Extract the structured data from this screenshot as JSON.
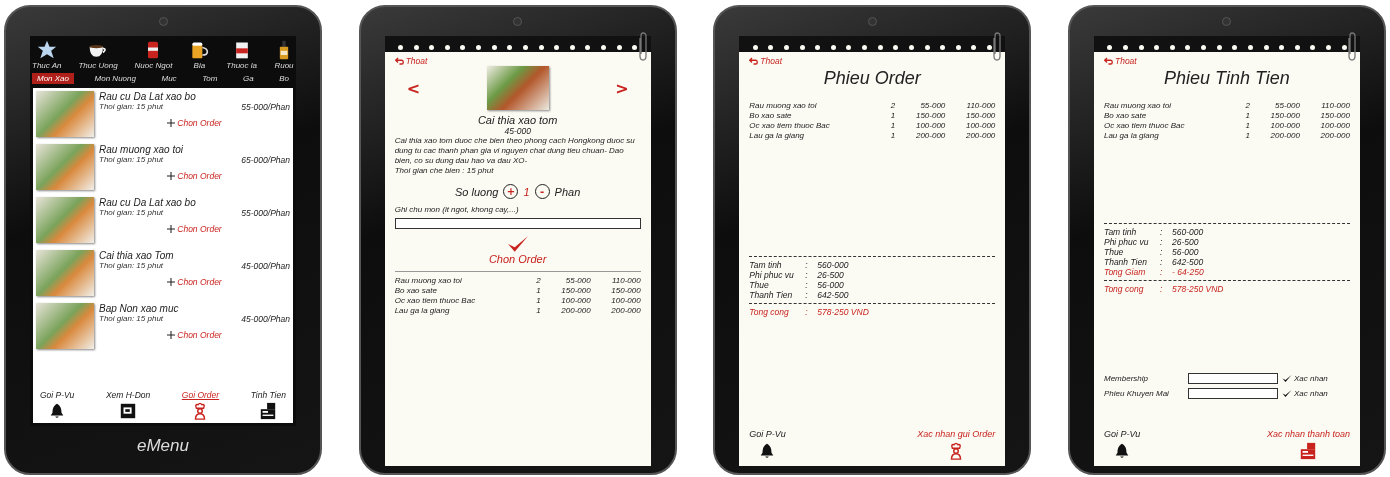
{
  "screens": [
    {
      "kind": "menu",
      "categories": [
        {
          "label": "Thuc An",
          "kind": "food"
        },
        {
          "label": "Thuc Uong",
          "kind": "coffee"
        },
        {
          "label": "Nuoc Ngot",
          "kind": "soda"
        },
        {
          "label": "Bia",
          "kind": "beer"
        },
        {
          "label": "Thuoc la",
          "kind": "tobacco"
        },
        {
          "label": "Ruou",
          "kind": "liquor"
        }
      ],
      "subcategories": [
        {
          "label": "Mon Xao",
          "selected": true
        },
        {
          "label": "Mon Nuong",
          "selected": false
        },
        {
          "label": "Muc",
          "selected": false
        },
        {
          "label": "Tom",
          "selected": false
        },
        {
          "label": "Ga",
          "selected": false
        },
        {
          "label": "Bo",
          "selected": false
        }
      ],
      "items": [
        {
          "name": "Rau cu Da Lat xao bo",
          "time": "Thoi gian: 15 phut",
          "price": "55-000/Phan",
          "action": "Chon Order"
        },
        {
          "name": "Rau muong xao toi",
          "time": "Thoi gian: 15 phut",
          "price": "65-000/Phan",
          "action": "Chon Order"
        },
        {
          "name": "Rau cu Da Lat xao bo",
          "time": "Thoi gian: 15 phut",
          "price": "55-000/Phan",
          "action": "Chon Order"
        },
        {
          "name": "Cai thia xao Tom",
          "time": "Thoi gian: 15 phut",
          "price": "45-000/Phan",
          "action": "Chon Order"
        },
        {
          "name": "Bap Non xao muc",
          "time": "Thoi gian: 15 phut",
          "price": "45-000/Phan",
          "action": "Chon Order"
        }
      ],
      "nav": [
        {
          "label": "Goi P-Vu",
          "kind": "service",
          "selected": false
        },
        {
          "label": "Xem H-Don",
          "kind": "invoice",
          "selected": false
        },
        {
          "label": "Goi Order",
          "kind": "order",
          "selected": true
        },
        {
          "label": "Tinh Tien",
          "kind": "payment",
          "selected": false
        }
      ],
      "brand": "eMenu"
    },
    {
      "kind": "detail",
      "exit": "Thoat",
      "prev": "<",
      "next": ">",
      "dish_name": "Cai thia xao tom",
      "price": "45-000",
      "description": "Cai thia xao tom duoc che bien theo phong cach Hongkong duoc su dung tu cac thanh phan gia vi nguyen chat dung tieu chuan- Dao bien, co su dung dau hao va dau XO-",
      "cook_time": "Thoi gian che bien : 15 phut",
      "quantity_label": "So luong",
      "plus": "+",
      "quantity": "1",
      "minus": "-",
      "unit": "Phan",
      "note_label": "Ghi chu mon (it ngot, khong cay,...)",
      "confirm": "Chon Order",
      "order_lines": [
        {
          "name": "Rau muong xao toi",
          "qty": "2",
          "price": "55-000",
          "amount": "110-000"
        },
        {
          "name": "Bo xao sate",
          "qty": "1",
          "price": "150-000",
          "amount": "150-000"
        },
        {
          "name": "Oc xao tiem thuoc Bac",
          "qty": "1",
          "price": "100-000",
          "amount": "100-000"
        },
        {
          "name": "Lau ga la giang",
          "qty": "1",
          "price": "200-000",
          "amount": "200-000"
        }
      ]
    },
    {
      "kind": "receipt",
      "exit": "Thoat",
      "title": "Phieu Order",
      "order_lines": [
        {
          "name": "Rau muong xao toi",
          "qty": "2",
          "price": "55-000",
          "amount": "110-000"
        },
        {
          "name": "Bo xao sate",
          "qty": "1",
          "price": "150-000",
          "amount": "150-000"
        },
        {
          "name": "Oc xao tiem thuoc Bac",
          "qty": "1",
          "price": "100-000",
          "amount": "100-000"
        },
        {
          "name": "Lau ga la giang",
          "qty": "1",
          "price": "200-000",
          "amount": "200-000"
        }
      ],
      "totals": [
        {
          "label": "Tam tinh",
          "sep": ":",
          "value": "560-000",
          "highlight": false
        },
        {
          "label": "Phi phuc vu",
          "sep": ":",
          "value": "26-500",
          "highlight": false
        },
        {
          "label": "Thue",
          "sep": ":",
          "value": "56-000",
          "highlight": false
        },
        {
          "label": "Thanh Tien",
          "sep": ":",
          "value": "642-500",
          "highlight": false
        }
      ],
      "grand_total": {
        "label": "Tong cong",
        "sep": ":",
        "value": "578-250 VND"
      },
      "footer_left": {
        "label": "Goi P-Vu",
        "kind": "service"
      },
      "footer_right": {
        "label": "Xac nhan gui Order",
        "kind": "order"
      }
    },
    {
      "kind": "receipt",
      "exit": "Thoat",
      "title": "Phieu Tinh Tien",
      "order_lines": [
        {
          "name": "Rau muong xao toi",
          "qty": "2",
          "price": "55-000",
          "amount": "110-000"
        },
        {
          "name": "Bo xao sate",
          "qty": "1",
          "price": "150-000",
          "amount": "150-000"
        },
        {
          "name": "Oc xao tiem thuoc Bac",
          "qty": "1",
          "price": "100-000",
          "amount": "100-000"
        },
        {
          "name": "Lau ga la giang",
          "qty": "1",
          "price": "200-000",
          "amount": "200-000"
        }
      ],
      "totals": [
        {
          "label": "Tam tinh",
          "sep": ":",
          "value": "560-000",
          "highlight": false
        },
        {
          "label": "Phi phuc vu",
          "sep": ":",
          "value": "26-500",
          "highlight": false
        },
        {
          "label": "Thue",
          "sep": ":",
          "value": "56-000",
          "highlight": false
        },
        {
          "label": "Thanh Tien",
          "sep": ":",
          "value": "642-500",
          "highlight": false
        },
        {
          "label": "Tong Giam",
          "sep": ":",
          "value": "- 64-250",
          "highlight": true
        }
      ],
      "grand_total": {
        "label": "Tong cong",
        "sep": ":",
        "value": "578-250 VND"
      },
      "codes": [
        {
          "label": "Membership",
          "action": "Xac nhan"
        },
        {
          "label": "Phieu Khuyen Mai",
          "action": "Xac nhan"
        }
      ],
      "footer_left": {
        "label": "Goi P-Vu",
        "kind": "service"
      },
      "footer_right": {
        "label": "Xac nhan thanh toan",
        "kind": "payment"
      }
    }
  ]
}
